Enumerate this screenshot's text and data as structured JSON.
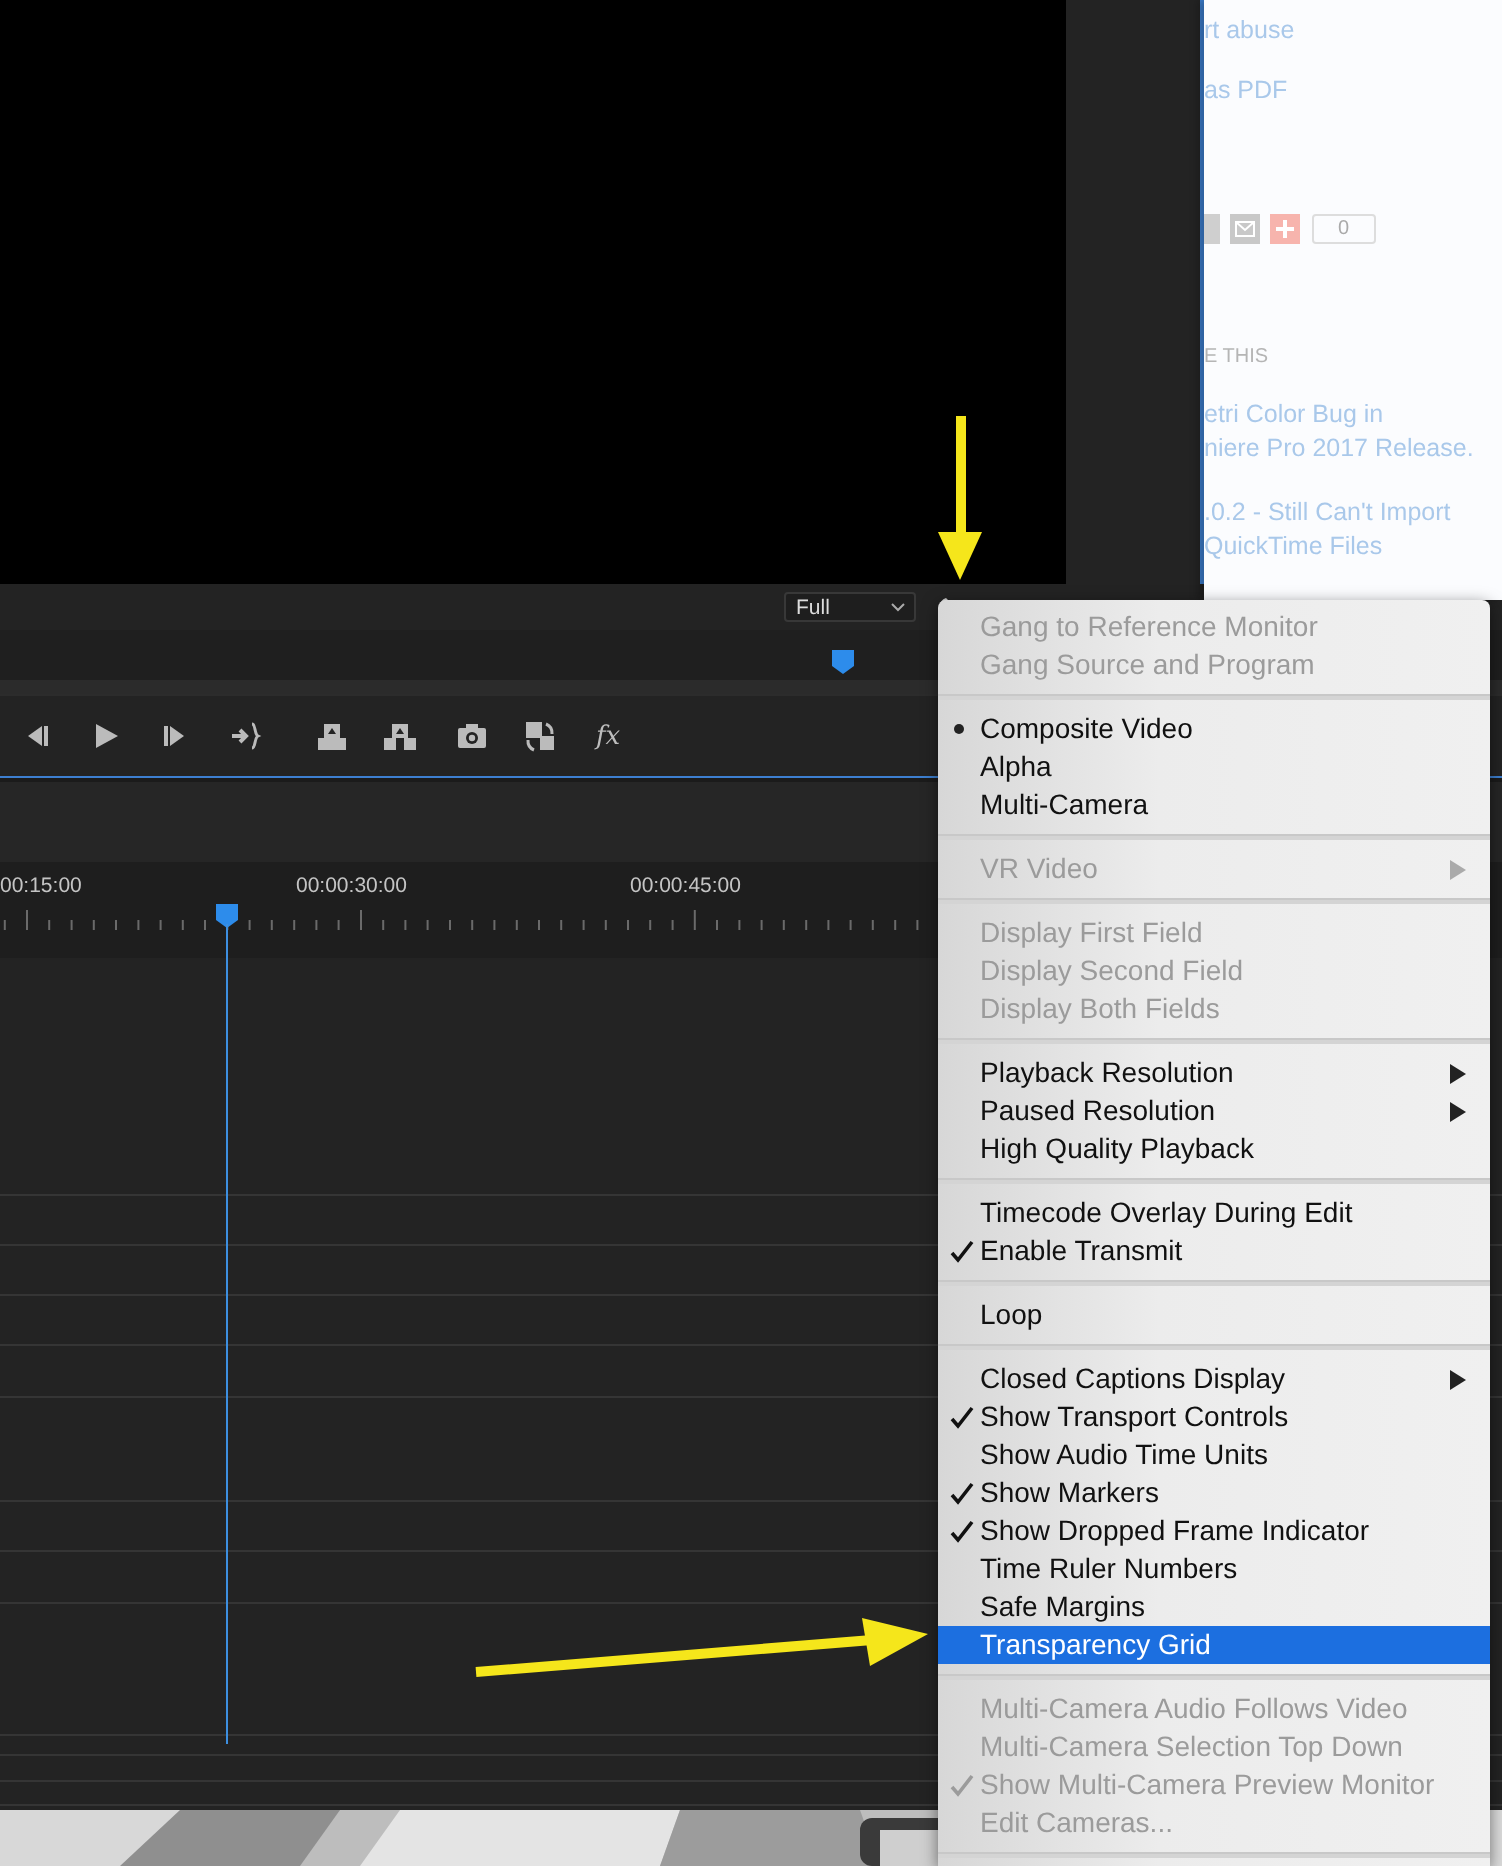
{
  "web_page": {
    "links": [
      {
        "label": "rt abuse"
      },
      {
        "label": "as PDF"
      }
    ],
    "share": {
      "count": "0"
    },
    "related_heading": "E THIS",
    "related": [
      {
        "lines": [
          "etri Color Bug in",
          "niere Pro 2017 Release."
        ]
      },
      {
        "lines": [
          ".0.2 - Still Can't Import",
          "QuickTime Files"
        ]
      }
    ]
  },
  "monitor": {
    "resolution": "Full"
  },
  "transport": [
    {
      "kind": "step-back"
    },
    {
      "kind": "play"
    },
    {
      "kind": "step-forward"
    },
    {
      "kind": "go-to-out"
    },
    {
      "kind": "lift"
    },
    {
      "kind": "extract"
    },
    {
      "kind": "export-frame"
    },
    {
      "kind": "compare"
    },
    {
      "kind": "fx",
      "label": "fx"
    }
  ],
  "timeline": {
    "ruler_labels": [
      "00:15:00",
      "00:00:30:00",
      "00:00:45:00"
    ]
  },
  "menu": {
    "sections": [
      [
        {
          "label": "Gang to Reference Monitor",
          "kind": "check",
          "checked": false,
          "disabled": true,
          "selected": false
        },
        {
          "label": "Gang Source and Program",
          "kind": "check",
          "checked": false,
          "disabled": true,
          "selected": false
        }
      ],
      [
        {
          "label": "Composite Video",
          "kind": "radio",
          "checked": true,
          "disabled": false,
          "selected": false
        },
        {
          "label": "Alpha",
          "kind": "radio",
          "checked": false,
          "disabled": false,
          "selected": false
        },
        {
          "label": "Multi-Camera",
          "kind": "radio",
          "checked": false,
          "disabled": false,
          "selected": false
        }
      ],
      [
        {
          "label": "VR Video",
          "kind": "submenu",
          "checked": false,
          "disabled": true,
          "selected": false
        }
      ],
      [
        {
          "label": "Display First Field",
          "kind": "radio",
          "checked": false,
          "disabled": true,
          "selected": false
        },
        {
          "label": "Display Second Field",
          "kind": "radio",
          "checked": false,
          "disabled": true,
          "selected": false
        },
        {
          "label": "Display Both Fields",
          "kind": "radio",
          "checked": false,
          "disabled": true,
          "selected": false
        }
      ],
      [
        {
          "label": "Playback Resolution",
          "kind": "submenu",
          "checked": false,
          "disabled": false,
          "selected": false
        },
        {
          "label": "Paused Resolution",
          "kind": "submenu",
          "checked": false,
          "disabled": false,
          "selected": false
        },
        {
          "label": "High Quality Playback",
          "kind": "check",
          "checked": false,
          "disabled": false,
          "selected": false
        }
      ],
      [
        {
          "label": "Timecode Overlay During Edit",
          "kind": "check",
          "checked": false,
          "disabled": false,
          "selected": false
        },
        {
          "label": "Enable Transmit",
          "kind": "check",
          "checked": true,
          "disabled": false,
          "selected": false
        }
      ],
      [
        {
          "label": "Loop",
          "kind": "check",
          "checked": false,
          "disabled": false,
          "selected": false
        }
      ],
      [
        {
          "label": "Closed Captions Display",
          "kind": "submenu",
          "checked": false,
          "disabled": false,
          "selected": false
        },
        {
          "label": "Show Transport Controls",
          "kind": "check",
          "checked": true,
          "disabled": false,
          "selected": false
        },
        {
          "label": "Show Audio Time Units",
          "kind": "check",
          "checked": false,
          "disabled": false,
          "selected": false
        },
        {
          "label": "Show Markers",
          "kind": "check",
          "checked": true,
          "disabled": false,
          "selected": false
        },
        {
          "label": "Show Dropped Frame Indicator",
          "kind": "check",
          "checked": true,
          "disabled": false,
          "selected": false
        },
        {
          "label": "Time Ruler Numbers",
          "kind": "check",
          "checked": false,
          "disabled": false,
          "selected": false
        },
        {
          "label": "Safe Margins",
          "kind": "check",
          "checked": false,
          "disabled": false,
          "selected": false
        },
        {
          "label": "Transparency Grid",
          "kind": "check",
          "checked": false,
          "disabled": false,
          "selected": true
        }
      ],
      [
        {
          "label": "Multi-Camera Audio Follows Video",
          "kind": "check",
          "checked": false,
          "disabled": true,
          "selected": false
        },
        {
          "label": "Multi-Camera Selection Top Down",
          "kind": "check",
          "checked": false,
          "disabled": true,
          "selected": false
        },
        {
          "label": "Show Multi-Camera Preview Monitor",
          "kind": "check",
          "checked": true,
          "disabled": true,
          "selected": false
        },
        {
          "label": "Edit Cameras...",
          "kind": "command",
          "checked": false,
          "disabled": true,
          "selected": false
        }
      ]
    ]
  }
}
